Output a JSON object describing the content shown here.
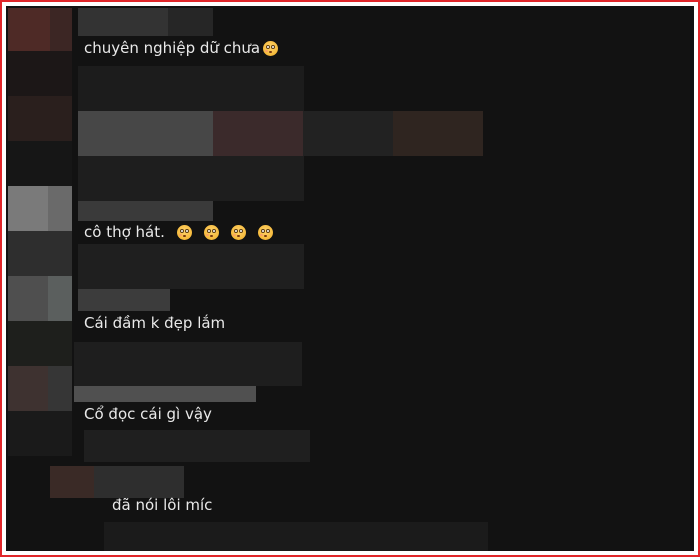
{
  "comments": [
    {
      "text": "chuyên nghiệp dữ chưa",
      "emoji": [
        "flushed-face"
      ]
    },
    {
      "text": "cô thợ hát.",
      "emoji": [
        "flushed-face",
        "flushed-face",
        "flushed-face",
        "flushed-face"
      ]
    },
    {
      "text": "Cái đầm k đẹp lắm",
      "emoji": []
    },
    {
      "text": "Cổ đọc cái gì vậy",
      "emoji": []
    },
    {
      "text": "đã nói lôi míc",
      "emoji": []
    }
  ],
  "colors": {
    "frame_border": "#e0262a",
    "background": "#121212",
    "text": "#e9e9e9",
    "emoji": "#f5b93a"
  }
}
